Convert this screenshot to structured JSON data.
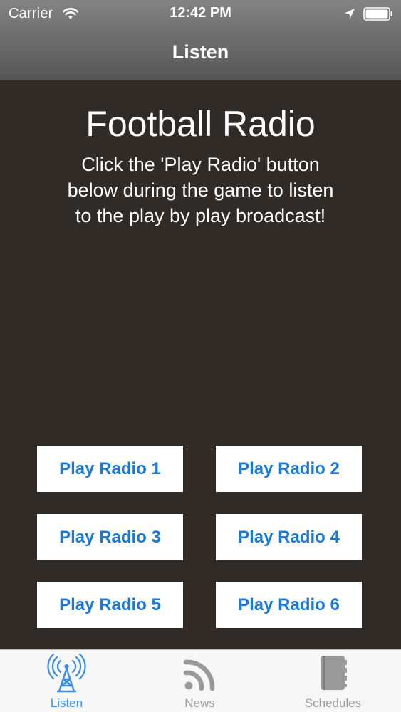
{
  "status_bar": {
    "carrier": "Carrier",
    "time": "12:42 PM",
    "wifi_icon": "wifi-icon",
    "location_icon": "location-arrow-icon",
    "battery_icon": "battery-icon"
  },
  "nav": {
    "title": "Listen"
  },
  "main": {
    "heading": "Football Radio",
    "description": "Click the 'Play Radio' button below during the game to listen to the play by play broadcast!",
    "buttons": [
      {
        "label": "Play Radio 1"
      },
      {
        "label": "Play Radio 2"
      },
      {
        "label": "Play Radio 3"
      },
      {
        "label": "Play Radio 4"
      },
      {
        "label": "Play Radio 5"
      },
      {
        "label": "Play Radio 6"
      }
    ]
  },
  "tab_bar": {
    "items": [
      {
        "label": "Listen",
        "icon": "radio-tower-icon",
        "active": true
      },
      {
        "label": "News",
        "icon": "rss-icon",
        "active": false
      },
      {
        "label": "Schedules",
        "icon": "notebook-icon",
        "active": false
      }
    ]
  },
  "colors": {
    "background": "#302b27",
    "button_text": "#1a78d6",
    "tab_active": "#3b8ee8",
    "tab_inactive": "#9a9a9a"
  }
}
